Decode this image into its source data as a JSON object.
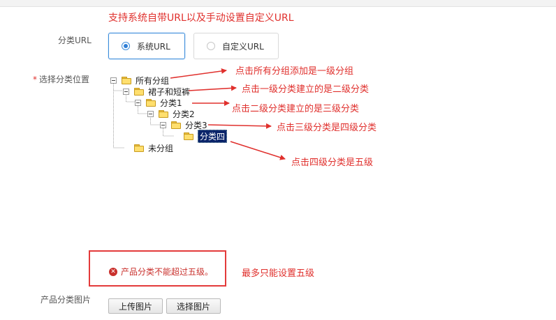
{
  "top_annotation": "支持系统自带URL以及手动设置自定义URL",
  "form": {
    "url_label": "分类URL",
    "url_options": [
      {
        "label": "系统URL",
        "selected": true
      },
      {
        "label": "自定义URL",
        "selected": false
      }
    ],
    "position_label": "选择分类位置",
    "required_mark": "*",
    "image_label": "产品分类图片",
    "upload_button": "上传图片",
    "choose_button": "选择图片"
  },
  "tree": {
    "root": "所有分组",
    "level1": "裙子和短裤",
    "level2": "分类1",
    "level3": "分类2",
    "level4": "分类3",
    "level5": "分类四",
    "ungrouped": "未分组"
  },
  "annotations": {
    "root_note": "点击所有分组添加是一级分组",
    "level1_note": "点击一级分类建立的是二级分类",
    "level2_note": "点击二级分类建立的是三级分类",
    "level3_note": "点击三级分类是四级分类",
    "level4_note": "点击四级分类是五级",
    "limit_note": "最多只能设置五级"
  },
  "error_message": "产品分类不能超过五级。",
  "colors": {
    "annotation": "#e0302d",
    "accent": "#3c8ddb",
    "error": "#c9302c"
  }
}
